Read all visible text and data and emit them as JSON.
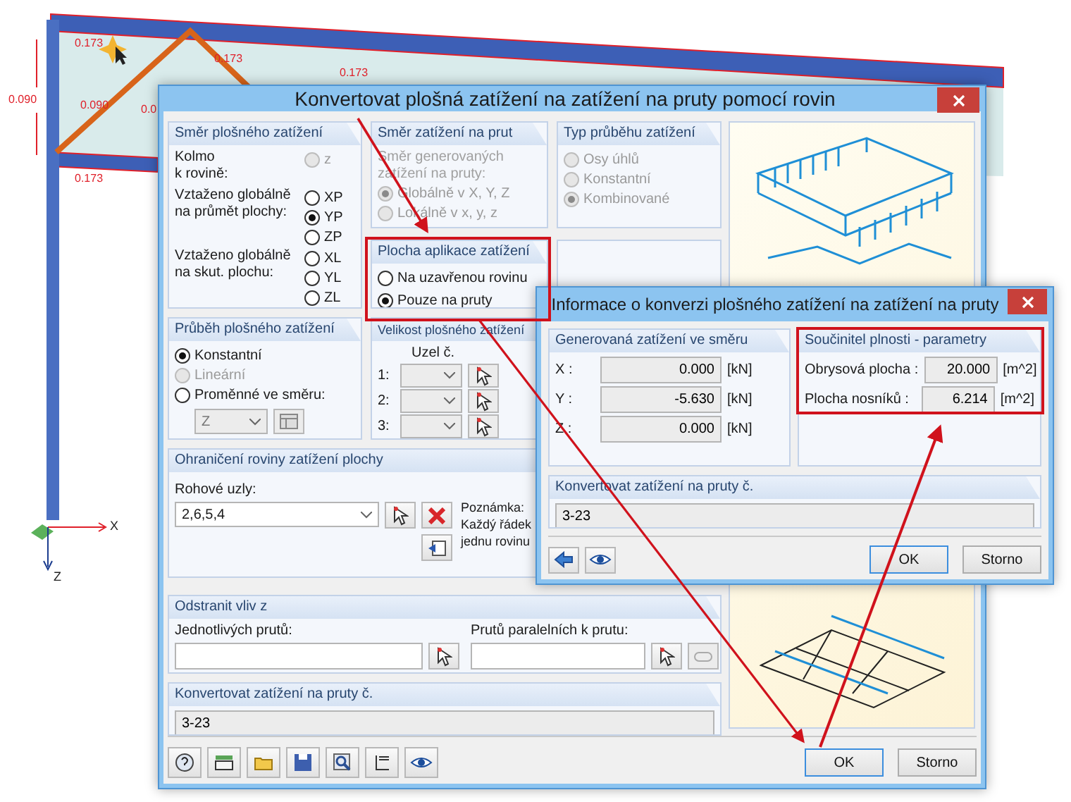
{
  "model": {
    "labels": [
      "0.173",
      "0.090",
      "0.090",
      "0.0",
      "0.173",
      "0.173",
      "0.173"
    ],
    "axes": {
      "x": "X",
      "z": "Z"
    }
  },
  "main_dialog": {
    "title": "Konvertovat plošná zatížení na zatížení na pruty pomocí rovin",
    "surface_direction": {
      "title": "Směr plošného zatížení",
      "rows": [
        {
          "label": "Kolmo\nk rovině:",
          "options": [
            {
              "label": "z",
              "selected": false,
              "disabled": true
            }
          ]
        },
        {
          "label": "Vztaženo globálně\nna průmět plochy:",
          "options": [
            {
              "label": "XP",
              "selected": false,
              "disabled": false
            },
            {
              "label": "YP",
              "selected": true,
              "disabled": false
            },
            {
              "label": "ZP",
              "selected": false,
              "disabled": false
            }
          ]
        },
        {
          "label": "Vztaženo globálně\nna skut. plochu:",
          "options": [
            {
              "label": "XL",
              "selected": false,
              "disabled": false
            },
            {
              "label": "YL",
              "selected": false,
              "disabled": false
            },
            {
              "label": "ZL",
              "selected": false,
              "disabled": false
            }
          ]
        }
      ]
    },
    "member_direction": {
      "title": "Směr zatížení na prut",
      "hint": "Směr generovaných zatížení na pruty:",
      "options": [
        {
          "label": "Globálně v X, Y, Z",
          "selected": true,
          "disabled": true
        },
        {
          "label": "Lokálně v x, y, z",
          "selected": false,
          "disabled": true
        }
      ]
    },
    "distribution_type": {
      "title": "Typ průběhu zatížení",
      "options": [
        {
          "label": "Osy úhlů",
          "selected": false,
          "disabled": true
        },
        {
          "label": "Konstantní",
          "selected": false,
          "disabled": true
        },
        {
          "label": "Kombinované",
          "selected": true,
          "disabled": true
        }
      ]
    },
    "application_area": {
      "title": "Plocha aplikace zatížení",
      "options": [
        {
          "label": "Na uzavřenou rovinu",
          "selected": false,
          "disabled": false
        },
        {
          "label": "Pouze na pruty",
          "selected": true,
          "disabled": false
        }
      ]
    },
    "surface_distribution": {
      "title": "Průběh plošného zatížení",
      "options": [
        {
          "label": "Konstantní",
          "selected": true,
          "disabled": false
        },
        {
          "label": "Lineární",
          "selected": false,
          "disabled": true
        },
        {
          "label": "Proměnné ve směru:",
          "selected": false,
          "disabled": false
        }
      ],
      "direction": "Z"
    },
    "magnitude": {
      "title": "Velikost plošného zatížení",
      "node_header": "Uzel č.",
      "rows": [
        "1:",
        "2:",
        "3:"
      ]
    },
    "boundary": {
      "title": "Ohraničení roviny zatížení plochy",
      "corner_label": "Rohové uzly:",
      "corner_value": "2,6,5,4",
      "note": [
        "Poznámka:",
        "Každý řádek",
        "jednu rovinu"
      ]
    },
    "exclude": {
      "title": "Odstranit vliv z",
      "single_label": "Jednotlivých prutů:",
      "parallel_label": "Prutů paralelních k prutu:"
    },
    "convert": {
      "title": "Konvertovat zatížení na pruty č.",
      "value": "3-23"
    },
    "buttons": [
      "OK",
      "Storno"
    ]
  },
  "info_dialog": {
    "title": "Informace o konverzi plošného zatížení na zatížení na pruty",
    "generated": {
      "title": "Generovaná zatížení ve směru",
      "rows": [
        {
          "axis": "X :",
          "value": "0.000",
          "unit": "[kN]"
        },
        {
          "axis": "Y :",
          "value": "-5.630",
          "unit": "[kN]"
        },
        {
          "axis": "Z :",
          "value": "0.000",
          "unit": "[kN]"
        }
      ]
    },
    "fill_factor": {
      "title": "Součinitel plnosti - parametry",
      "rows": [
        {
          "label": "Obrysová plocha :",
          "value": "20.000",
          "unit": "[m^2]"
        },
        {
          "label": "Plocha nosníků :",
          "value": "6.214",
          "unit": "[m^2]"
        }
      ]
    },
    "convert": {
      "title": "Konvertovat zatížení na pruty č.",
      "value": "3-23"
    },
    "buttons": [
      "OK",
      "Storno"
    ]
  }
}
